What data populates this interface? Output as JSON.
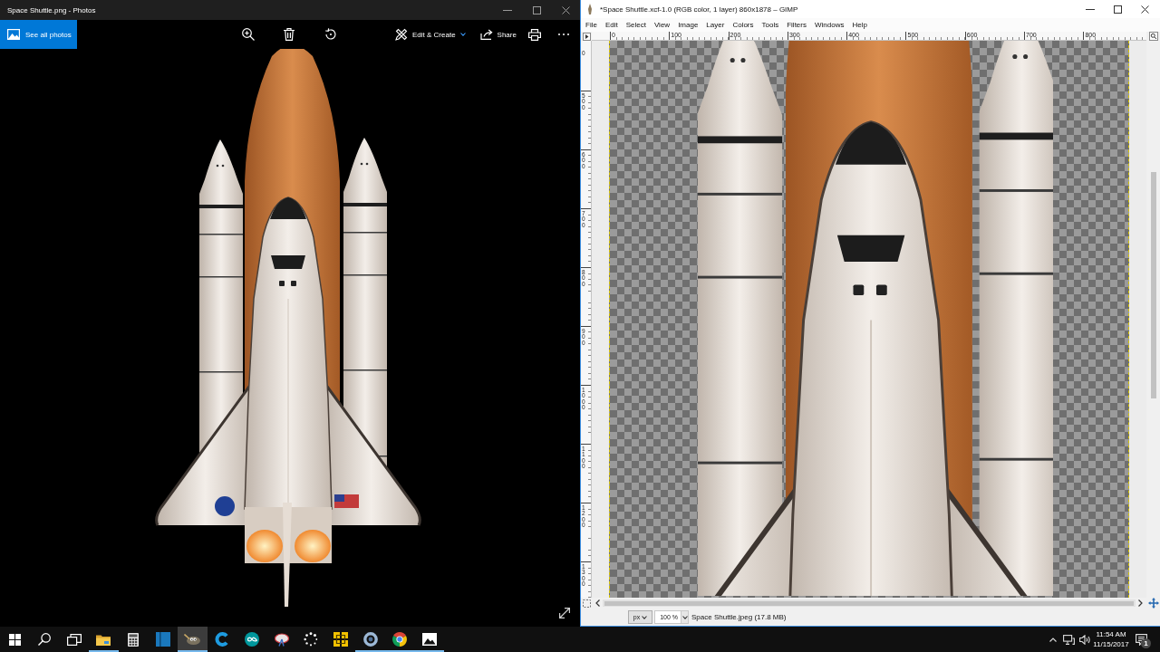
{
  "photos_window": {
    "title": "Space Shuttle.png - Photos",
    "toolbar": {
      "see_all_photos": "See all photos",
      "edit_create": "Edit & Create",
      "share": "Share"
    }
  },
  "gimp_window": {
    "title": "*Space Shuttle.xcf-1.0 (RGB color, 1 layer) 860x1878 – GIMP",
    "menu": [
      "File",
      "Edit",
      "Select",
      "View",
      "Image",
      "Layer",
      "Colors",
      "Tools",
      "Filters",
      "Windows",
      "Help"
    ],
    "horizontal_ruler": [
      "0",
      "100",
      "200",
      "300",
      "400",
      "500",
      "600",
      "700",
      "800"
    ],
    "vertical_ruler": {
      "cut_label": "0",
      "labels": [
        "500",
        "600",
        "700",
        "800",
        "900",
        "1000",
        "1100",
        "1200",
        "1300"
      ]
    },
    "status_bar": {
      "unit": "px",
      "zoom": "100 %",
      "info": "Space Shuttle.jpeg (17.8 MB)"
    }
  },
  "taskbar": {
    "apps": [
      {
        "kind": "folder",
        "running": true,
        "selected": false
      },
      {
        "kind": "calculator",
        "running": false,
        "selected": false
      },
      {
        "kind": "panel",
        "running": false,
        "selected": false
      },
      {
        "kind": "paint",
        "running": true,
        "selected": true
      },
      {
        "kind": "arc",
        "running": false,
        "selected": false
      },
      {
        "kind": "infinity",
        "running": false,
        "selected": false
      },
      {
        "kind": "dish",
        "running": false,
        "selected": false
      },
      {
        "kind": "spinner",
        "running": false,
        "selected": false
      },
      {
        "kind": "blocks",
        "running": false,
        "selected": false
      },
      {
        "kind": "ring",
        "running": true,
        "selected": false
      },
      {
        "kind": "browser",
        "running": true,
        "selected": false
      },
      {
        "kind": "image",
        "running": true,
        "selected": false
      }
    ],
    "tray": {
      "time": "11:54 AM",
      "date": "11/15/2017",
      "notification_count": "1"
    }
  }
}
